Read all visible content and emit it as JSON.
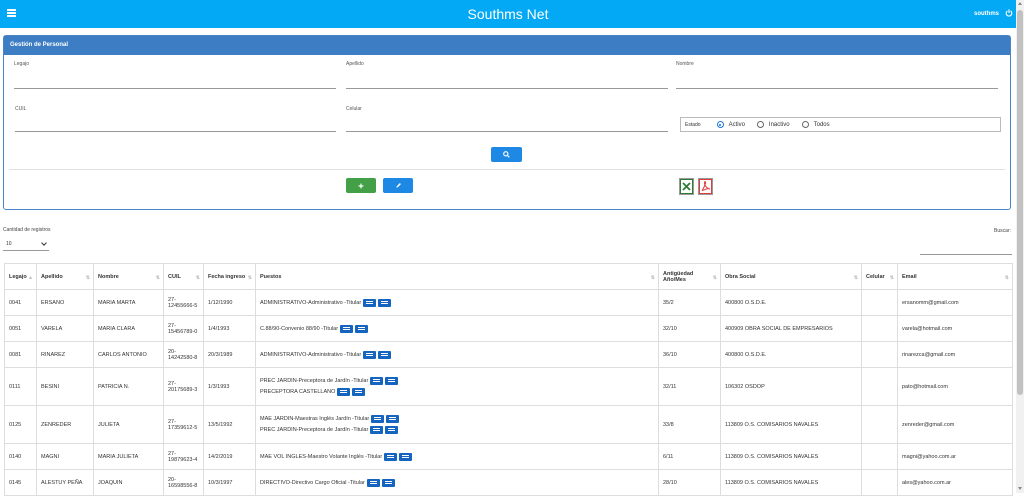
{
  "header": {
    "title": "Southms Net",
    "user": "southms"
  },
  "panel": {
    "title": "Gestión de Personal",
    "fields": {
      "legajo": "Legajo",
      "apellido": "Apellido",
      "nombre": "Nombre",
      "cuil": "CUIL",
      "celular": "Celular"
    },
    "estado": {
      "label": "Estado",
      "options": [
        "Activo",
        "Inactivo",
        "Todos"
      ],
      "selected": "Activo"
    }
  },
  "list_controls": {
    "cantidad_label": "Cantidad de registros",
    "cantidad_value": "10",
    "buscar_label": "Buscar:"
  },
  "table": {
    "headers": [
      "Legajo",
      "Apellido",
      "Nombre",
      "CUIL",
      "Fecha ingreso",
      "Puestos",
      "Antigüedad Año/Mes",
      "Obra Social",
      "Celular",
      "Email"
    ],
    "rows": [
      {
        "legajo": "0041",
        "apellido": "ERSANO",
        "nombre": "MARIA MARTA",
        "cuil": "27-12455666-5",
        "fecha": "1/12/1990",
        "puestos": [
          "ADMINISTRATIVO-Administrativo -Titular"
        ],
        "antiguedad": "35/2",
        "obra": "400800 O.S.D.E.",
        "celular": "",
        "email": "ersanomm@gmail.com"
      },
      {
        "legajo": "0051",
        "apellido": "VARELA",
        "nombre": "MARIA CLARA",
        "cuil": "27-15456789-0",
        "fecha": "1/4/1993",
        "puestos": [
          "C.88/90-Convenio 88/90 -Titular"
        ],
        "antiguedad": "32/10",
        "obra": "400909 OBRA SOCIAL DE EMPRESARIOS",
        "celular": "",
        "email": "varela@hotmail.com"
      },
      {
        "legajo": "0081",
        "apellido": "RINAREZ",
        "nombre": "CARLOS ANTONIO",
        "cuil": "20-14242580-8",
        "fecha": "20/3/1989",
        "puestos": [
          "ADMINISTRATIVO-Administrativo -Titular"
        ],
        "antiguedad": "36/10",
        "obra": "400800 O.S.D.E.",
        "celular": "",
        "email": "rinarezca@gmail.com"
      },
      {
        "legajo": "0111",
        "apellido": "BESINI",
        "nombre": "PATRICIA N.",
        "cuil": "27-20175689-3",
        "fecha": "1/3/1993",
        "puestos": [
          "PREC JARDIN-Preceptora de Jardín -Titular",
          "PRECEPTORA CASTELLANO"
        ],
        "antiguedad": "32/11",
        "obra": "106302 OSDOP",
        "celular": "",
        "email": "pato@hotmail.com"
      },
      {
        "legajo": "0125",
        "apellido": "ZENREDER",
        "nombre": "JULIETA",
        "cuil": "27-17359612-5",
        "fecha": "13/5/1992",
        "puestos": [
          "MAE JARDIN-Maestras Inglés Jardín -Titular",
          "PREC JARDIN-Preceptora de Jardín -Titular"
        ],
        "antiguedad": "33/8",
        "obra": "113809 O.S. COMISARIOS NAVALES",
        "celular": "",
        "email": "zenreder@gmail.com"
      },
      {
        "legajo": "0140",
        "apellido": "MAGNI",
        "nombre": "MARIA JULIETA",
        "cuil": "27-19879623-4",
        "fecha": "14/2/2019",
        "puestos": [
          "MAE VOL INGLES-Maestro Volante Inglés -Titular"
        ],
        "antiguedad": "6/11",
        "obra": "113809 O.S. COMISARIOS NAVALES",
        "celular": "",
        "email": "magni@yahoo.com.ar"
      },
      {
        "legajo": "0145",
        "apellido": "ALESTUY PEÑA",
        "nombre": "JOAQUIN",
        "cuil": "20-16598556-8",
        "fecha": "10/3/1997",
        "puestos": [
          "DIRECTIVO-Directivo Cargo Oficial -Titular"
        ],
        "antiguedad": "28/10",
        "obra": "113809 O.S. COMISARIOS NAVALES",
        "celular": "",
        "email": "ales@yahoo.com.ar"
      }
    ]
  },
  "icons": {
    "menu": "hamburger-icon",
    "power": "power-icon",
    "search": "search-icon",
    "add": "plus-icon",
    "edit": "pencil-icon",
    "excel": "excel-icon",
    "pdf": "pdf-icon",
    "row_actions": [
      "id-card-icon",
      "list-icon"
    ]
  },
  "colors": {
    "topbar": "#03a9f4",
    "panel_header": "#3c7dc4",
    "primary": "#1e88e5",
    "success": "#43a047",
    "pdf": "#e53935",
    "excel": "#2e7d32"
  }
}
